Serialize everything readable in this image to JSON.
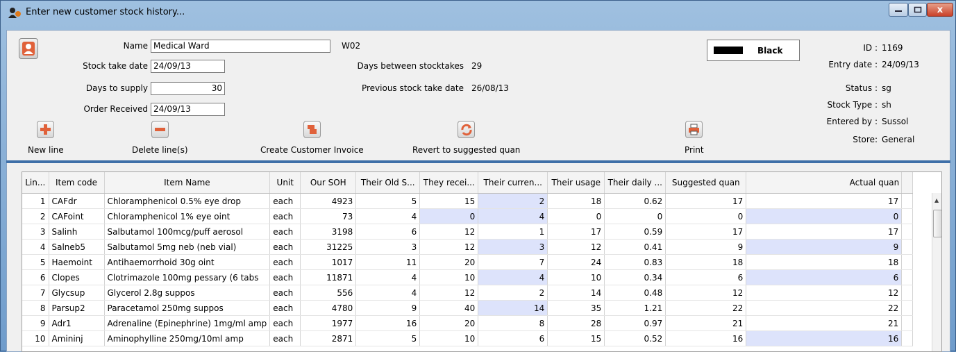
{
  "window": {
    "title": "Enter new customer stock history...",
    "close_glyph": "x"
  },
  "form": {
    "name_label": "Name",
    "name_value": "Medical Ward",
    "code_value": "W02",
    "stock_take_date_label": "Stock take date",
    "stock_take_date_value": "24/09/13",
    "days_to_supply_label": "Days to supply",
    "days_to_supply_value": "30",
    "order_received_label": "Order Received",
    "order_received_value": "24/09/13",
    "days_between_label": "Days between stocktakes",
    "days_between_value": "29",
    "previous_label": "Previous stock take date",
    "previous_value": "26/08/13",
    "color_name": "Black",
    "color_hex": "#000000"
  },
  "info": {
    "id_label": "ID :",
    "id_value": "1169",
    "entry_date_label": "Entry date :",
    "entry_date_value": "24/09/13",
    "status_label": "Status :",
    "status_value": "sg",
    "stock_type_label": "Stock Type :",
    "stock_type_value": "sh",
    "entered_by_label": "Entered by :",
    "entered_by_value": "Sussol",
    "store_label": "Store:",
    "store_value": "General"
  },
  "toolbar": {
    "new_line": "New line",
    "delete_line": "Delete line(s)",
    "create_invoice": "Create Customer Invoice",
    "revert": "Revert to suggested quan",
    "print": "Print"
  },
  "table": {
    "headers": [
      "Lin...",
      "Item code",
      "Item Name",
      "Unit",
      "Our SOH",
      "Their Old S...",
      "They recei...",
      "Their curren...",
      "Their usage",
      "Their daily ...",
      "Suggested quan",
      "Actual quan"
    ],
    "rows": [
      [
        "1",
        "CAFdr",
        "Chloramphenicol 0.5% eye drop",
        "each",
        "4923",
        "5",
        "15",
        "2",
        "18",
        "0.62",
        "17",
        "17"
      ],
      [
        "2",
        "CAFoint",
        "Chloramphenicol 1% eye oint",
        "each",
        "73",
        "4",
        "0",
        "4",
        "0",
        "0",
        "0",
        "0"
      ],
      [
        "3",
        "Salinh",
        "Salbutamol 100mcg/puff aerosol",
        "each",
        "3198",
        "6",
        "12",
        "1",
        "17",
        "0.59",
        "17",
        "17"
      ],
      [
        "4",
        "Salneb5",
        "Salbutamol 5mg neb (neb vial)",
        "each",
        "31225",
        "3",
        "12",
        "3",
        "12",
        "0.41",
        "9",
        "9"
      ],
      [
        "5",
        "Haemoint",
        "Antihaemorrhoid 30g oint",
        "each",
        "1017",
        "11",
        "20",
        "7",
        "24",
        "0.83",
        "18",
        "18"
      ],
      [
        "6",
        "Clopes",
        "Clotrimazole 100mg pessary (6 tabs",
        "each",
        "11871",
        "4",
        "10",
        "4",
        "10",
        "0.34",
        "6",
        "6"
      ],
      [
        "7",
        "Glycsup",
        "Glycerol 2.8g suppos",
        "each",
        "556",
        "4",
        "12",
        "2",
        "14",
        "0.48",
        "12",
        "12"
      ],
      [
        "8",
        "Parsup2",
        "Paracetamol 250mg suppos",
        "each",
        "4780",
        "9",
        "40",
        "14",
        "35",
        "1.21",
        "22",
        "22"
      ],
      [
        "9",
        "Adr1",
        "Adrenaline (Epinephrine) 1mg/ml amp",
        "each",
        "1977",
        "16",
        "20",
        "8",
        "28",
        "0.97",
        "21",
        "21"
      ],
      [
        "10",
        "Amininj",
        "Aminophylline 250mg/10ml amp",
        "each",
        "2871",
        "5",
        "10",
        "6",
        "15",
        "0.52",
        "16",
        "16"
      ]
    ],
    "highlight_cells": [
      [
        0,
        7
      ],
      [
        1,
        6
      ],
      [
        1,
        7
      ],
      [
        1,
        11
      ],
      [
        3,
        7
      ],
      [
        3,
        11
      ],
      [
        5,
        7
      ],
      [
        5,
        11
      ],
      [
        7,
        7
      ],
      [
        9,
        11
      ]
    ]
  }
}
